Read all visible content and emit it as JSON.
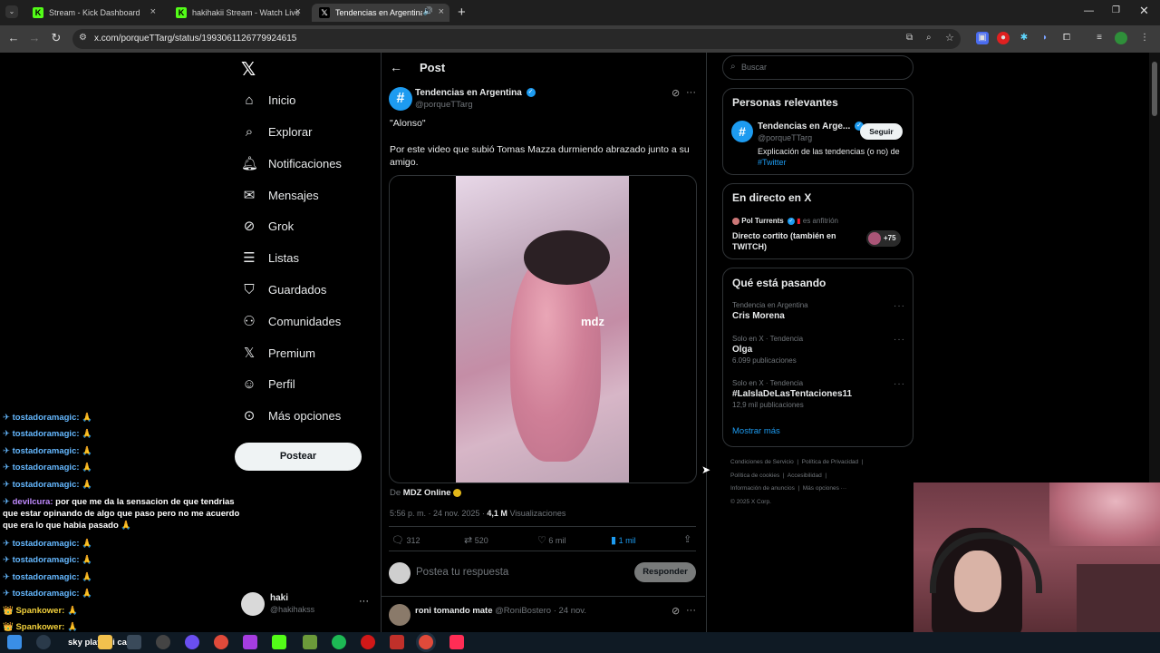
{
  "browser": {
    "tabs": [
      {
        "title": "Stream - Kick Dashboard",
        "icon": "kick-icon",
        "active": false
      },
      {
        "title": "hakihakii Stream - Watch Live o",
        "icon": "kick-icon",
        "active": false
      },
      {
        "title": "Tendencias en Argentina en",
        "icon": "x-icon",
        "active": true
      }
    ],
    "url": "x.com/porqueTTarg/status/1993061126779924615"
  },
  "nav": {
    "items": [
      "Inicio",
      "Explorar",
      "Notificaciones",
      "Mensajes",
      "Grok",
      "Listas",
      "Guardados",
      "Comunidades",
      "Premium",
      "Perfil",
      "Más opciones"
    ],
    "post_button": "Postear",
    "account": {
      "name": "haki",
      "handle": "@hakihakss"
    }
  },
  "post": {
    "header": "Post",
    "author_name": "Tendencias en Argentina",
    "author_handle": "@porqueTTarg",
    "text1": "\"Alonso\"",
    "text2": "Por este video que subió Tomas Mazza durmiendo abrazado junto a su amigo.",
    "watermark": "mdz",
    "source_prefix": "De",
    "source_name": "MDZ Online",
    "timestamp": "5:56 p. m. · 24 nov. 2025 ·",
    "views_count": "4,1 M",
    "views_label": "Visualizaciones",
    "replies": "312",
    "reposts": "520",
    "likes": "6 mil",
    "bookmarks": "1 mil",
    "reply_placeholder": "Postea tu respuesta",
    "reply_button": "Responder",
    "next_reply_name": "roni tomando mate",
    "next_reply_meta": "@RoniBostero · 24 nov."
  },
  "sidebar": {
    "search_placeholder": "Buscar",
    "relevant": {
      "title": "Personas relevantes",
      "name": "Tendencias en Arge...",
      "handle": "@porqueTTarg",
      "follow": "Seguir",
      "bio": "Explicación de las tendencias (o no) de",
      "bio_link": "#Twitter"
    },
    "live": {
      "title": "En directo en X",
      "host": "Pol Turrents",
      "host_suffix": "es anfitrión",
      "stream_title": "Directo cortito (también en TWITCH)",
      "listeners": "+75"
    },
    "trends": {
      "title": "Qué está pasando",
      "items": [
        {
          "context": "Tendencia en Argentina",
          "name": "Cris Morena",
          "count": ""
        },
        {
          "context": "Solo en X · Tendencia",
          "name": "Olga",
          "count": "6.099 publicaciones"
        },
        {
          "context": "Solo en X · Tendencia",
          "name": "#LaIslaDeLasTentaciones11",
          "count": "12,9 mil publicaciones"
        }
      ],
      "show_more": "Mostrar más"
    },
    "footer": {
      "line1": [
        "Condiciones de Servicio",
        "Política de Privacidad"
      ],
      "line2": [
        "Política de cookies",
        "Accesibilidad"
      ],
      "line3": [
        "Información de anuncios",
        "Más opciones ···"
      ],
      "copyright": "© 2025 X Corp."
    }
  },
  "chat": [
    {
      "user": "tostadoramagic:",
      "msg": "",
      "color": "blue"
    },
    {
      "user": "tostadoramagic:",
      "msg": "",
      "color": "blue"
    },
    {
      "user": "tostadoramagic:",
      "msg": "",
      "color": "blue"
    },
    {
      "user": "tostadoramagic:",
      "msg": "",
      "color": "blue"
    },
    {
      "user": "tostadoramagic:",
      "msg": "",
      "color": "blue"
    },
    {
      "user": "devilcura:",
      "msg": "por que me da la sensacion de que tendrias que estar opinando de algo que paso pero no me acuerdo que era lo que habia pasado",
      "color": "purple"
    },
    {
      "user": "tostadoramagic:",
      "msg": "",
      "color": "blue"
    },
    {
      "user": "tostadoramagic:",
      "msg": "",
      "color": "blue"
    },
    {
      "user": "tostadoramagic:",
      "msg": "",
      "color": "blue"
    },
    {
      "user": "tostadoramagic:",
      "msg": "",
      "color": "blue"
    },
    {
      "user": "Spankower:",
      "msg": "",
      "color": "yellow"
    },
    {
      "user": "Spankower:",
      "msg": "",
      "color": "yellow"
    }
  ],
  "now_playing": "sky playboi carti"
}
